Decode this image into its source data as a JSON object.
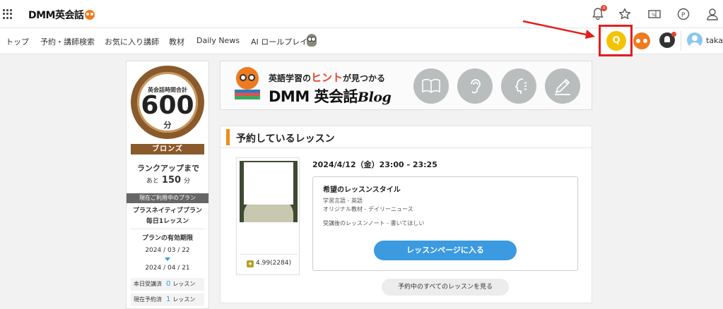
{
  "header": {
    "logo_text": "DMM英会話",
    "bell_count": "4"
  },
  "nav": {
    "items": [
      "トップ",
      "予約・講師検索",
      "お気に入り講師",
      "教材",
      "Daily News",
      "AI ロールプレイ"
    ],
    "q_icon_label": "Q",
    "username": "taka"
  },
  "annotation": {
    "arrow_color": "#e02020"
  },
  "sidebar": {
    "medal_label": "英会話時間合計",
    "total_minutes": "600",
    "minutes_unit": "分",
    "rank": "ブロンズ",
    "rankup_label": "ランクアップまで",
    "remain_prefix": "あと",
    "remain_value": "150",
    "remain_unit": "分",
    "plan_header": "現在ご利用中のプラン",
    "plan_name_line1": "プラスネイティブプラン",
    "plan_name_line2": "毎日1レッスン",
    "expiry_title": "プランの有効期限",
    "start_date": "2024 / 03 / 22",
    "end_date": "2024 / 04 / 21",
    "stats": [
      {
        "label": "本日受講済",
        "value": "0",
        "unit": "レッスン"
      },
      {
        "label": "現在予約済",
        "value": "1",
        "unit": "レッスン"
      }
    ]
  },
  "banner": {
    "tagline_pre": "英語学習の",
    "tagline_hint": "ヒント",
    "tagline_post": "が見つかる",
    "title_main": "DMM 英会話",
    "title_blog": "Blog",
    "icons": [
      "book-icon",
      "ear-icon",
      "speaking-head-icon",
      "pencil-icon"
    ]
  },
  "reservations": {
    "title": "予約しているレッスン",
    "lesson_datetime": "2024/4/12（金）23:00 - 23:25",
    "tutor_rating": "4.99(2284)",
    "style_title": "希望のレッスンスタイル",
    "style_lines": [
      "学習言語 - 英語",
      "オリジナル教材 - デイリーニュース",
      "受講後のレッスンノート - 書いてほしい"
    ],
    "lesson_page_button": "レッスンページに入る",
    "all_lessons_button": "予約中のすべてのレッスンを見る"
  },
  "colors": {
    "accent_blue": "#3b9ae0",
    "bronze": "#8a5a2b",
    "brand_orange": "#ef7a1f",
    "highlight_red": "#e02020"
  }
}
